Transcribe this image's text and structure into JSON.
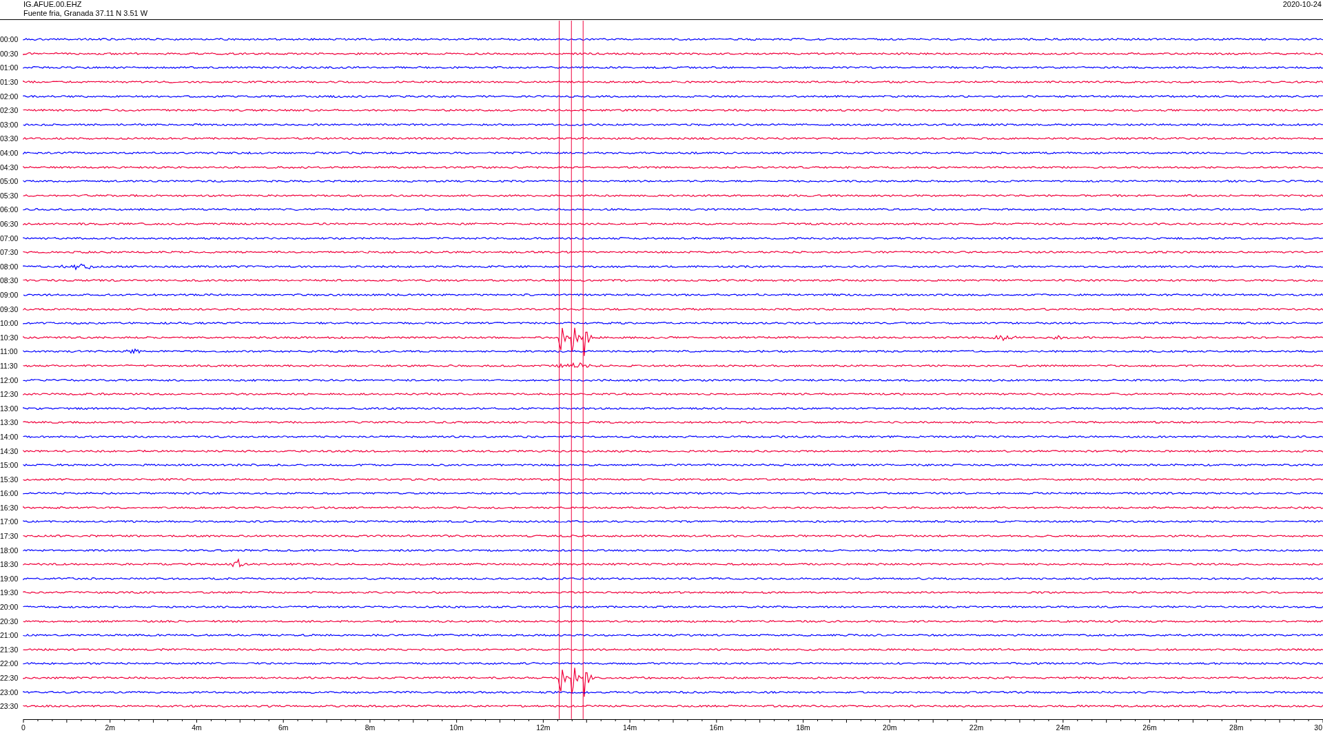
{
  "header": {
    "station": "IG.AFUE.00.EHZ",
    "location": "Fuente fria, Granada  37.11 N 3.51 W",
    "date": "2020-10-24"
  },
  "rows": [
    {
      "time": "00:00",
      "color": "#0000ff"
    },
    {
      "time": "00:30",
      "color": "#f0003c"
    },
    {
      "time": "01:00",
      "color": "#0000ff"
    },
    {
      "time": "01:30",
      "color": "#f0003c"
    },
    {
      "time": "02:00",
      "color": "#0000ff"
    },
    {
      "time": "02:30",
      "color": "#f0003c"
    },
    {
      "time": "03:00",
      "color": "#0000ff"
    },
    {
      "time": "03:30",
      "color": "#f0003c"
    },
    {
      "time": "04:00",
      "color": "#0000ff"
    },
    {
      "time": "04:30",
      "color": "#f0003c"
    },
    {
      "time": "05:00",
      "color": "#0000ff"
    },
    {
      "time": "05:30",
      "color": "#f0003c"
    },
    {
      "time": "06:00",
      "color": "#0000ff"
    },
    {
      "time": "06:30",
      "color": "#f0003c"
    },
    {
      "time": "07:00",
      "color": "#0000ff"
    },
    {
      "time": "07:30",
      "color": "#f0003c"
    },
    {
      "time": "08:00",
      "color": "#0000ff"
    },
    {
      "time": "08:30",
      "color": "#f0003c"
    },
    {
      "time": "09:00",
      "color": "#0000ff"
    },
    {
      "time": "09:30",
      "color": "#f0003c"
    },
    {
      "time": "10:00",
      "color": "#0000ff"
    },
    {
      "time": "10:30",
      "color": "#f0003c"
    },
    {
      "time": "11:00",
      "color": "#0000ff"
    },
    {
      "time": "11:30",
      "color": "#f0003c"
    },
    {
      "time": "12:00",
      "color": "#0000ff"
    },
    {
      "time": "12:30",
      "color": "#f0003c"
    },
    {
      "time": "13:00",
      "color": "#0000ff"
    },
    {
      "time": "13:30",
      "color": "#f0003c"
    },
    {
      "time": "14:00",
      "color": "#0000ff"
    },
    {
      "time": "14:30",
      "color": "#f0003c"
    },
    {
      "time": "15:00",
      "color": "#0000ff"
    },
    {
      "time": "15:30",
      "color": "#f0003c"
    },
    {
      "time": "16:00",
      "color": "#0000ff"
    },
    {
      "time": "16:30",
      "color": "#f0003c"
    },
    {
      "time": "17:00",
      "color": "#0000ff"
    },
    {
      "time": "17:30",
      "color": "#f0003c"
    },
    {
      "time": "18:00",
      "color": "#0000ff"
    },
    {
      "time": "18:30",
      "color": "#f0003c"
    },
    {
      "time": "19:00",
      "color": "#0000ff"
    },
    {
      "time": "19:30",
      "color": "#f0003c"
    },
    {
      "time": "20:00",
      "color": "#0000ff"
    },
    {
      "time": "20:30",
      "color": "#f0003c"
    },
    {
      "time": "21:00",
      "color": "#0000ff"
    },
    {
      "time": "21:30",
      "color": "#f0003c"
    },
    {
      "time": "22:00",
      "color": "#0000ff"
    },
    {
      "time": "22:30",
      "color": "#f0003c"
    },
    {
      "time": "23:00",
      "color": "#0000ff"
    },
    {
      "time": "23:30",
      "color": "#f0003c"
    }
  ],
  "x_axis": {
    "labels": [
      "0",
      "2m",
      "4m",
      "6m",
      "8m",
      "10m",
      "12m",
      "14m",
      "16m",
      "18m",
      "20m",
      "22m",
      "24m",
      "26m",
      "28m",
      "30"
    ]
  }
}
